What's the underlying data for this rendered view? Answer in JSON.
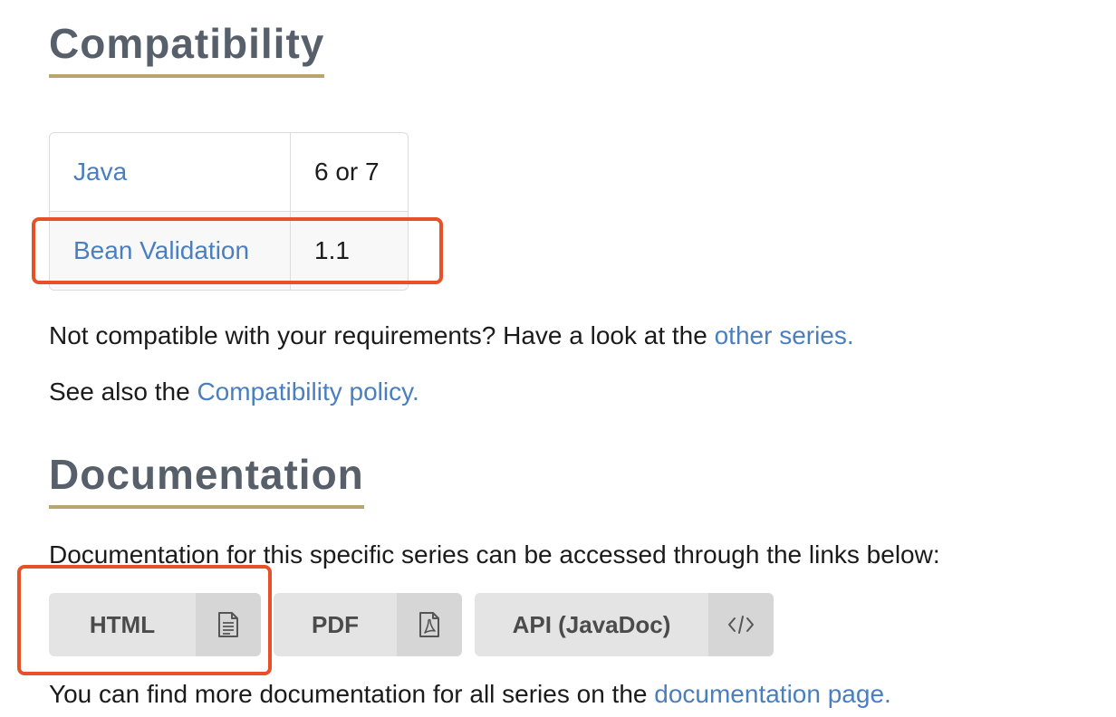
{
  "compatibility": {
    "title": "Compatibility",
    "rows": [
      {
        "key": "Java",
        "value": "6 or 7"
      },
      {
        "key": "Bean Validation",
        "value": "1.1"
      }
    ],
    "not_compatible_text": "Not compatible with your requirements? Have a look at the ",
    "other_series_link": "other series.",
    "see_also_text": "See also the ",
    "policy_link": "Compatibility policy."
  },
  "documentation": {
    "title": "Documentation",
    "intro": "Documentation for this specific series can be accessed through the links below:",
    "buttons": [
      {
        "label": "HTML",
        "icon": "document-icon"
      },
      {
        "label": "PDF",
        "icon": "pdf-icon"
      },
      {
        "label": "API (JavaDoc)",
        "icon": "code-icon"
      }
    ],
    "more_text": "You can find more documentation for all series on the ",
    "more_link": "documentation page."
  },
  "highlight_color": "#e8502a",
  "link_color": "#4a7fbf",
  "heading_underline_color": "#b8a46f"
}
